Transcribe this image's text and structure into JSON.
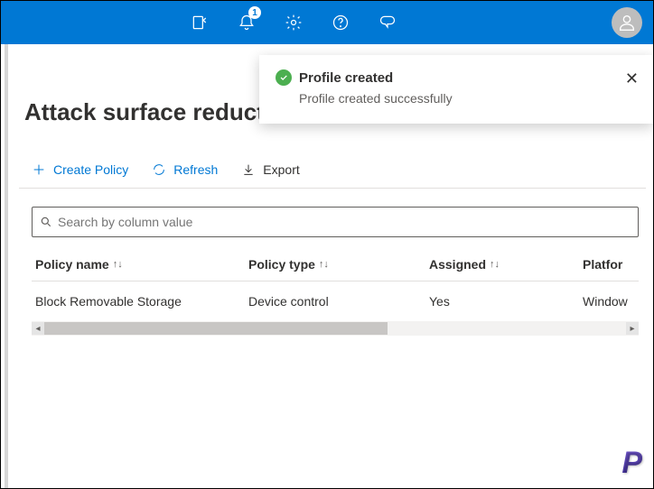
{
  "header": {
    "notification_count": "1"
  },
  "toast": {
    "title": "Profile created",
    "subtitle": "Profile created successfully"
  },
  "page": {
    "title": "Attack surface reduction"
  },
  "toolbar": {
    "create": "Create Policy",
    "refresh": "Refresh",
    "export": "Export"
  },
  "search": {
    "placeholder": "Search by column value"
  },
  "table": {
    "columns": {
      "name": "Policy name",
      "type": "Policy type",
      "assigned": "Assigned",
      "platform": "Platfor"
    },
    "rows": [
      {
        "name": "Block Removable Storage",
        "type": "Device control",
        "assigned": "Yes",
        "platform": "Window"
      }
    ]
  },
  "brand": "P"
}
